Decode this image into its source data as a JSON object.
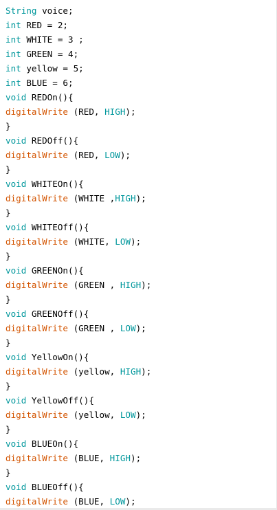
{
  "theme": {
    "background": "#ffffff",
    "keyword_color": "#00979c",
    "function_color": "#d35400",
    "text_color": "#000000"
  },
  "code_lines": [
    [
      {
        "t": "String",
        "k": "type"
      },
      {
        "t": " voice;",
        "k": "plain"
      }
    ],
    [
      {
        "t": "int",
        "k": "type"
      },
      {
        "t": " RED = 2;",
        "k": "plain"
      }
    ],
    [
      {
        "t": "int",
        "k": "type"
      },
      {
        "t": " WHITE = 3 ;",
        "k": "plain"
      }
    ],
    [
      {
        "t": "int",
        "k": "type"
      },
      {
        "t": " GREEN = 4;",
        "k": "plain"
      }
    ],
    [
      {
        "t": "int",
        "k": "type"
      },
      {
        "t": " yellow = 5;",
        "k": "plain"
      }
    ],
    [
      {
        "t": "int",
        "k": "type"
      },
      {
        "t": " BLUE = 6;",
        "k": "plain"
      }
    ],
    [
      {
        "t": "void",
        "k": "type"
      },
      {
        "t": " REDOn(){",
        "k": "plain"
      }
    ],
    [
      {
        "t": "digitalWrite",
        "k": "func"
      },
      {
        "t": " (RED, ",
        "k": "plain"
      },
      {
        "t": "HIGH",
        "k": "const"
      },
      {
        "t": ");",
        "k": "plain"
      }
    ],
    [
      {
        "t": "}",
        "k": "plain"
      }
    ],
    [
      {
        "t": "void",
        "k": "type"
      },
      {
        "t": " REDOff(){",
        "k": "plain"
      }
    ],
    [
      {
        "t": "digitalWrite",
        "k": "func"
      },
      {
        "t": " (RED, ",
        "k": "plain"
      },
      {
        "t": "LOW",
        "k": "const"
      },
      {
        "t": ");",
        "k": "plain"
      }
    ],
    [
      {
        "t": "}",
        "k": "plain"
      }
    ],
    [
      {
        "t": "void",
        "k": "type"
      },
      {
        "t": " WHITEOn(){",
        "k": "plain"
      }
    ],
    [
      {
        "t": "digitalWrite",
        "k": "func"
      },
      {
        "t": " (WHITE ,",
        "k": "plain"
      },
      {
        "t": "HIGH",
        "k": "const"
      },
      {
        "t": ");",
        "k": "plain"
      }
    ],
    [
      {
        "t": "}",
        "k": "plain"
      }
    ],
    [
      {
        "t": "void",
        "k": "type"
      },
      {
        "t": " WHITEOff(){",
        "k": "plain"
      }
    ],
    [
      {
        "t": "digitalWrite",
        "k": "func"
      },
      {
        "t": " (WHITE, ",
        "k": "plain"
      },
      {
        "t": "LOW",
        "k": "const"
      },
      {
        "t": ");",
        "k": "plain"
      }
    ],
    [
      {
        "t": "}",
        "k": "plain"
      }
    ],
    [
      {
        "t": "void",
        "k": "type"
      },
      {
        "t": " GREENOn(){",
        "k": "plain"
      }
    ],
    [
      {
        "t": "digitalWrite",
        "k": "func"
      },
      {
        "t": " (GREEN , ",
        "k": "plain"
      },
      {
        "t": "HIGH",
        "k": "const"
      },
      {
        "t": ");",
        "k": "plain"
      }
    ],
    [
      {
        "t": "}",
        "k": "plain"
      }
    ],
    [
      {
        "t": "void",
        "k": "type"
      },
      {
        "t": " GREENOff(){",
        "k": "plain"
      }
    ],
    [
      {
        "t": "digitalWrite",
        "k": "func"
      },
      {
        "t": " (GREEN , ",
        "k": "plain"
      },
      {
        "t": "LOW",
        "k": "const"
      },
      {
        "t": ");",
        "k": "plain"
      }
    ],
    [
      {
        "t": "}",
        "k": "plain"
      }
    ],
    [
      {
        "t": "void",
        "k": "type"
      },
      {
        "t": " YellowOn(){",
        "k": "plain"
      }
    ],
    [
      {
        "t": "digitalWrite",
        "k": "func"
      },
      {
        "t": " (yellow, ",
        "k": "plain"
      },
      {
        "t": "HIGH",
        "k": "const"
      },
      {
        "t": ");",
        "k": "plain"
      }
    ],
    [
      {
        "t": "}",
        "k": "plain"
      }
    ],
    [
      {
        "t": "void",
        "k": "type"
      },
      {
        "t": " YellowOff(){",
        "k": "plain"
      }
    ],
    [
      {
        "t": "digitalWrite",
        "k": "func"
      },
      {
        "t": " (yellow, ",
        "k": "plain"
      },
      {
        "t": "LOW",
        "k": "const"
      },
      {
        "t": ");",
        "k": "plain"
      }
    ],
    [
      {
        "t": "}",
        "k": "plain"
      }
    ],
    [
      {
        "t": "void",
        "k": "type"
      },
      {
        "t": " BLUEOn(){",
        "k": "plain"
      }
    ],
    [
      {
        "t": "digitalWrite",
        "k": "func"
      },
      {
        "t": " (BLUE, ",
        "k": "plain"
      },
      {
        "t": "HIGH",
        "k": "const"
      },
      {
        "t": ");",
        "k": "plain"
      }
    ],
    [
      {
        "t": "}",
        "k": "plain"
      }
    ],
    [
      {
        "t": "void",
        "k": "type"
      },
      {
        "t": " BLUEOff(){",
        "k": "plain"
      }
    ],
    [
      {
        "t": "digitalWrite",
        "k": "func"
      },
      {
        "t": " (BLUE, ",
        "k": "plain"
      },
      {
        "t": "LOW",
        "k": "const"
      },
      {
        "t": ");",
        "k": "plain"
      }
    ]
  ]
}
